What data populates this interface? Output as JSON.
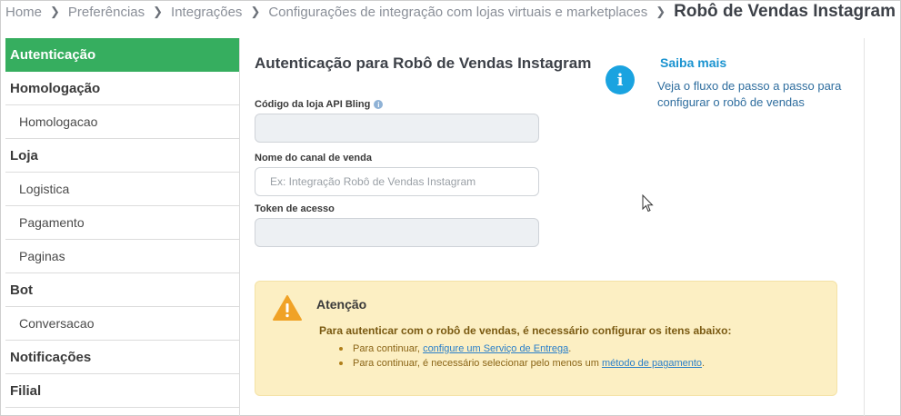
{
  "breadcrumb": {
    "items": [
      "Home",
      "Preferências",
      "Integrações",
      "Configurações de integração com lojas virtuais e marketplaces"
    ],
    "current": "Robô de Vendas Instagram"
  },
  "sidebar": {
    "items": [
      {
        "label": "Autenticação",
        "type": "header",
        "active": true
      },
      {
        "label": "Homologação",
        "type": "header"
      },
      {
        "label": "Homologacao",
        "type": "sub"
      },
      {
        "label": "Loja",
        "type": "header"
      },
      {
        "label": "Logistica",
        "type": "sub"
      },
      {
        "label": "Pagamento",
        "type": "sub"
      },
      {
        "label": "Paginas",
        "type": "sub"
      },
      {
        "label": "Bot",
        "type": "header"
      },
      {
        "label": "Conversacao",
        "type": "sub"
      },
      {
        "label": "Notificações",
        "type": "header"
      },
      {
        "label": "Filial",
        "type": "header"
      }
    ]
  },
  "main": {
    "title": "Autenticação para Robô de Vendas Instagram",
    "fields": {
      "api_code": {
        "label": "Código da loja API Bling",
        "value": "",
        "placeholder": ""
      },
      "channel_name": {
        "label": "Nome do canal de venda",
        "value": "",
        "placeholder": "Ex: Integração Robô de Vendas Instagram"
      },
      "token": {
        "label": "Token de acesso",
        "value": "",
        "placeholder": ""
      }
    }
  },
  "saiba_mais": {
    "title": "Saiba mais",
    "text": "Veja o fluxo de passo a passo para configurar o robô de vendas"
  },
  "alert": {
    "title": "Atenção",
    "description": "Para autenticar com o robô de vendas, é necessário configurar os itens abaixo:",
    "items": [
      {
        "prefix": "Para continuar, ",
        "link": "configure um Serviço de Entrega",
        "suffix": "."
      },
      {
        "prefix": "Para continuar, é necessário selecionar pelo menos um ",
        "link": "método de pagamento",
        "suffix": "."
      }
    ]
  },
  "colors": {
    "sidebar_active": "#36ae5f",
    "info_blue": "#1aa3e0",
    "alert_bg": "#fcefc3",
    "warning_orange": "#f0a226",
    "link": "#2a7fc9"
  }
}
